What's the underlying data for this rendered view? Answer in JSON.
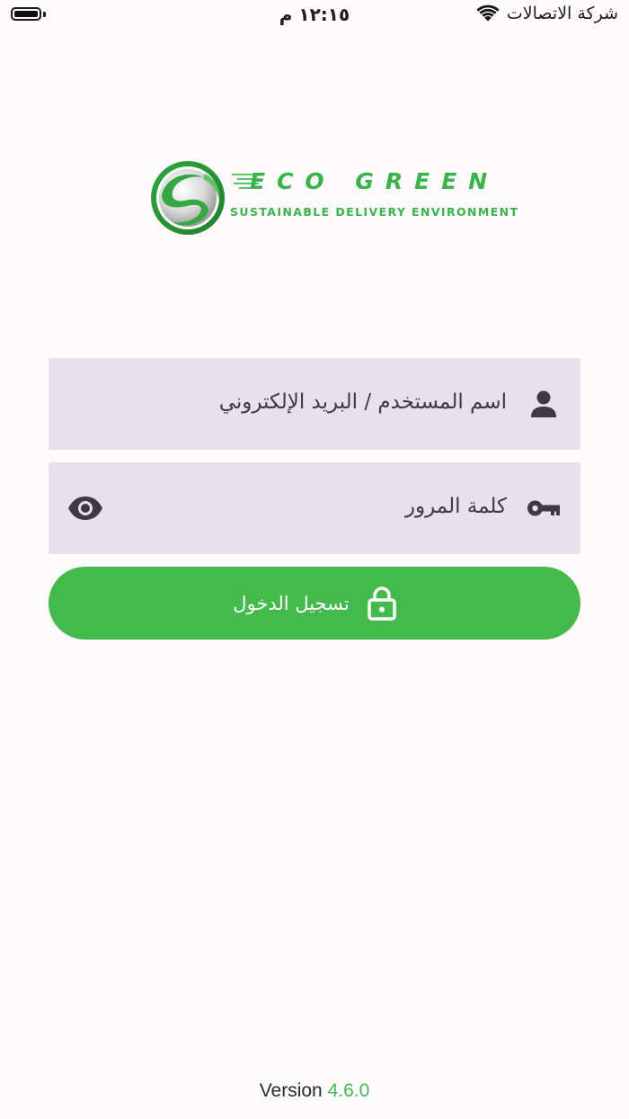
{
  "status_bar": {
    "time": "١٢:١٥ م",
    "carrier": "شركة الاتصالات",
    "battery_icon": "battery-icon",
    "wifi_icon": "wifi-icon"
  },
  "logo": {
    "title": "ECO GREEN",
    "subtitle": "SUSTAINABLE DELIVERY ENVIRONMENT",
    "mark_icon": "eco-green-logo-mark"
  },
  "login_form": {
    "username_placeholder": "اسم المستخدم / البريد الإلكتروني",
    "username_icon": "person-icon",
    "password_placeholder": "كلمة المرور",
    "password_icon": "key-icon",
    "password_toggle_icon": "eye-icon",
    "submit_label": "تسجيل الدخول",
    "submit_icon": "lock-icon"
  },
  "footer": {
    "version_label": "Version",
    "version_number": "4.6.0"
  },
  "colors": {
    "background": "#fefbfd",
    "accent_green": "#44ba4c",
    "field_background": "#e6e1eb",
    "icon_dark": "#3d3a42"
  }
}
